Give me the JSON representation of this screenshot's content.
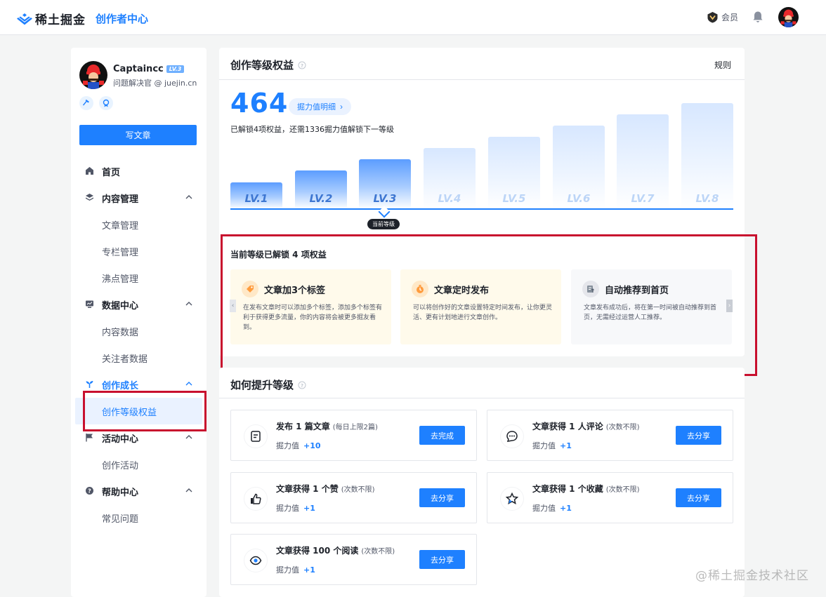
{
  "header": {
    "logo_text": "稀土掘金",
    "sub_title": "创作者中心",
    "vip_label": "会员"
  },
  "user": {
    "name": "Captaincc",
    "level_badge": "LV.3",
    "title": "问题解决官 @ juejin.cn"
  },
  "sidebar": {
    "write_label": "写文章",
    "items": [
      {
        "label": "首页",
        "type": "group"
      },
      {
        "label": "内容管理",
        "type": "group"
      },
      {
        "label": "文章管理",
        "type": "sub"
      },
      {
        "label": "专栏管理",
        "type": "sub"
      },
      {
        "label": "沸点管理",
        "type": "sub"
      },
      {
        "label": "数据中心",
        "type": "group"
      },
      {
        "label": "内容数据",
        "type": "sub"
      },
      {
        "label": "关注者数据",
        "type": "sub"
      },
      {
        "label": "创作成长",
        "type": "group"
      },
      {
        "label": "创作等级权益",
        "type": "sub"
      },
      {
        "label": "活动中心",
        "type": "group"
      },
      {
        "label": "创作活动",
        "type": "sub"
      },
      {
        "label": "帮助中心",
        "type": "group"
      },
      {
        "label": "常见问题",
        "type": "sub"
      }
    ]
  },
  "level": {
    "title": "创作等级权益",
    "rules_label": "规则",
    "score": "464",
    "detail_label": "掘力值明细",
    "unlock_desc": "已解锁4项权益，还需1336掘力值解锁下一等级",
    "levels": [
      "LV.1",
      "LV.2",
      "LV.3",
      "LV.4",
      "LV.5",
      "LV.6",
      "LV.7",
      "LV.8"
    ],
    "current_level": 3,
    "current_tag": "当前等级",
    "rights_title": "当前等级已解锁 4 项权益",
    "rights": [
      {
        "title": "文章加3个标签",
        "desc": "在发布文章时可以添加多个标签，添加多个标签有利于获得更多流量，你的内容将会被更多掘友看到。"
      },
      {
        "title": "文章定时发布",
        "desc": "可以将创作好的文章设置特定时间发布，让你更灵活、更有计划地进行文章创作。"
      },
      {
        "title": "自动推荐到首页",
        "desc": "文章发布成功后，将在第一时间被自动推荐到首页，无需经过运营人工推荐。"
      }
    ]
  },
  "growth": {
    "title": "如何提升等级",
    "points_label": "掘力值",
    "tasks": [
      {
        "title": "发布 1 篇文章",
        "note": "(每日上限2篇)",
        "points": "+10",
        "button": "去完成"
      },
      {
        "title": "文章获得 1 人评论",
        "note": "(次数不限)",
        "points": "+1",
        "button": "去分享"
      },
      {
        "title": "文章获得 1 个赞",
        "note": "(次数不限)",
        "points": "+1",
        "button": "去分享"
      },
      {
        "title": "文章获得 1 个收藏",
        "note": "(次数不限)",
        "points": "+1",
        "button": "去分享"
      },
      {
        "title": "文章获得 100 个阅读",
        "note": "(次数不限)",
        "points": "+1",
        "button": "去分享"
      }
    ]
  },
  "watermark": "@稀土掘金技术社区",
  "colors": {
    "accent": "#1e80ff",
    "highlight_box": "#c8102e"
  }
}
